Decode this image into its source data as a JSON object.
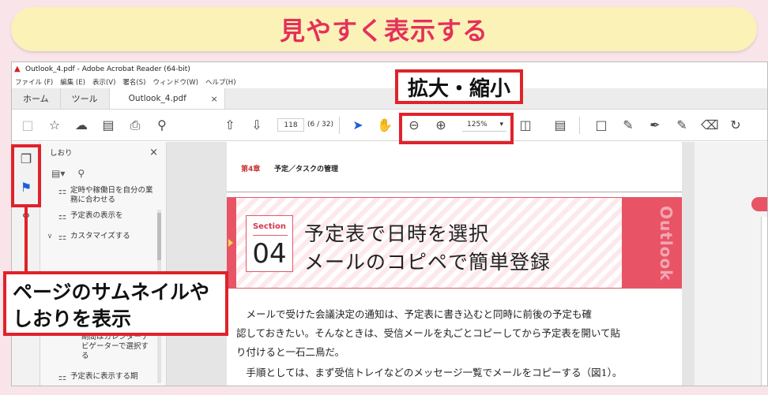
{
  "banner": {
    "title": "見やすく表示する"
  },
  "window": {
    "title": "Outlook_4.pdf - Adobe Acrobat Reader (64-bit)",
    "menu": [
      "ファイル (F)",
      "編集 (E)",
      "表示(V)",
      "署名(S)",
      "ウィンドウ(W)",
      "ヘルプ(H)"
    ],
    "tabs": {
      "home": "ホーム",
      "tools": "ツール",
      "doc": "Outlook_4.pdf",
      "close": "×"
    }
  },
  "toolbar": {
    "page_current": "118",
    "page_count": "(6 / 32)",
    "zoom": "125%"
  },
  "bookmarks": {
    "title": "しおり",
    "close": "×",
    "items": [
      "定時や稼働日を自分の業務に合わせる",
      "予定表の表示を",
      "カスタマイズする",
      "期間はカレンダーナビゲーターで選択する",
      "予定表に表示する期"
    ]
  },
  "page": {
    "chapter": "第4章",
    "chapter_title": "予定／タスクの管理",
    "section_label": "Section",
    "section_number": "04",
    "title_line1": "予定表で日時を選択",
    "title_line2": "メールのコピペで簡単登録",
    "side_word": "Outlook",
    "body": [
      "　メールで受けた会議決定の通知は、予定表に書き込むと同時に前後の予定も確",
      "認しておきたい。そんなときは、受信メールを丸ごとコピーしてから予定表を開いて貼",
      "り付けると一石二鳥だ。",
      "　手順としては、まず受信トレイなどのメッセージ一覧でメールをコピーする（図1）。"
    ]
  },
  "callouts": {
    "zoom": "拡大・縮小",
    "thumbnails_line1": "ページのサムネイルや",
    "thumbnails_line2": "しおりを表示"
  },
  "colors": {
    "accent": "#e0222a",
    "banner_text": "#e5305a",
    "section_pink": "#e85466"
  }
}
